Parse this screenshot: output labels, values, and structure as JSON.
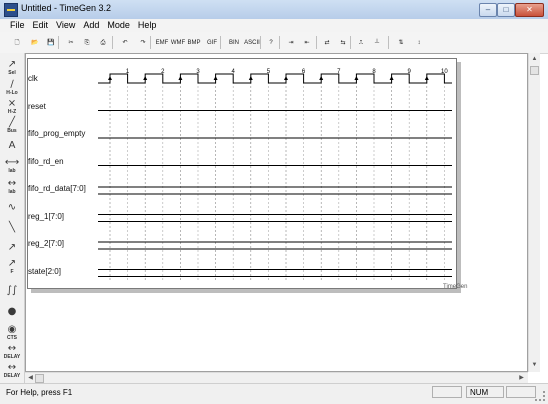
{
  "window": {
    "title": "Untitled - TimeGen 3.2",
    "minimize": "–",
    "maximize": "□",
    "close": "✕"
  },
  "menu": [
    "File",
    "Edit",
    "View",
    "Add",
    "Mode",
    "Help"
  ],
  "toolbar": {
    "buttons": [
      {
        "name": "new-icon",
        "glyph": "🗋"
      },
      {
        "name": "open-icon",
        "glyph": "📂"
      },
      {
        "name": "save-icon",
        "glyph": "💾"
      },
      {
        "name": "cut-icon",
        "glyph": "✂"
      },
      {
        "name": "copy-icon",
        "glyph": "⎘"
      },
      {
        "name": "print-icon",
        "glyph": "⎙"
      },
      {
        "name": "undo-icon",
        "glyph": "↶"
      },
      {
        "name": "redo-icon",
        "glyph": "↷"
      },
      {
        "name": "copy-clipboard-icon",
        "glyph": "EMF"
      },
      {
        "name": "copy-wmf-icon",
        "glyph": "WMF"
      },
      {
        "name": "copy-bmp-icon",
        "glyph": "BMP"
      },
      {
        "name": "copy-gif-icon",
        "glyph": "GIF"
      },
      {
        "name": "binary-icon",
        "glyph": "BIN"
      },
      {
        "name": "ascii-icon",
        "glyph": "ASCII"
      },
      {
        "name": "help-icon",
        "glyph": "?"
      },
      {
        "name": "zoom-in-h-icon",
        "glyph": "⇥"
      },
      {
        "name": "zoom-out-h-icon",
        "glyph": "⇤"
      },
      {
        "name": "expand-icon",
        "glyph": "⇄"
      },
      {
        "name": "shrink-icon",
        "glyph": "⇆"
      },
      {
        "name": "clock-wave-icon",
        "glyph": "⎍"
      },
      {
        "name": "marker-icon",
        "glyph": "┴"
      },
      {
        "name": "zoom-in-v-icon",
        "glyph": "⇅"
      },
      {
        "name": "zoom-out-v-icon",
        "glyph": "↕"
      }
    ]
  },
  "left_tools": [
    {
      "name": "select-tool",
      "glyph": "↗",
      "label": "Sel"
    },
    {
      "name": "edge-lh-tool",
      "glyph": "∕",
      "label": "H-Lo"
    },
    {
      "name": "edge-hz-tool",
      "glyph": "⨯",
      "label": "H-Z"
    },
    {
      "name": "edge-bus-tool",
      "glyph": "╱",
      "label": "Bus"
    },
    {
      "name": "text-tool",
      "glyph": "A",
      "label": ""
    },
    {
      "name": "label-tool",
      "glyph": "⟷",
      "label": "lab"
    },
    {
      "name": "label2-tool",
      "glyph": "↔",
      "label": "lab"
    },
    {
      "name": "curve-tool",
      "glyph": "∿",
      "label": ""
    },
    {
      "name": "line-tool",
      "glyph": "╲",
      "label": ""
    },
    {
      "name": "arrow-tool",
      "glyph": "↗",
      "label": ""
    },
    {
      "name": "fall-tool",
      "glyph": "↗",
      "label": "F"
    },
    {
      "name": "break-tool",
      "glyph": "∫∫",
      "label": ""
    },
    {
      "name": "bus-tool",
      "glyph": "●",
      "label": ""
    },
    {
      "name": "cts-tool",
      "glyph": "◉",
      "label": "CTS"
    },
    {
      "name": "delay-tool",
      "glyph": "↔",
      "label": "DELAY"
    },
    {
      "name": "delay2-tool",
      "glyph": "↔",
      "label": "DELAY"
    }
  ],
  "diagram": {
    "signals": [
      {
        "name": "clk",
        "kind": "clock"
      },
      {
        "name": "reset",
        "kind": "line"
      },
      {
        "name": "fifo_prog_empty",
        "kind": "line"
      },
      {
        "name": "fifo_rd_en",
        "kind": "line"
      },
      {
        "name": "fifo_rd_data[7:0]",
        "kind": "bus"
      },
      {
        "name": "reg_1[7:0]",
        "kind": "bus"
      },
      {
        "name": "reg_2[7:0]",
        "kind": "bus"
      },
      {
        "name": "state[2:0]",
        "kind": "bus"
      }
    ],
    "clock_labels": [
      "1",
      "2",
      "3",
      "4",
      "5",
      "6",
      "7",
      "8",
      "9",
      "10"
    ],
    "watermark": "TimeGen"
  },
  "status": {
    "help": "For Help, press F1",
    "num": "NUM"
  }
}
